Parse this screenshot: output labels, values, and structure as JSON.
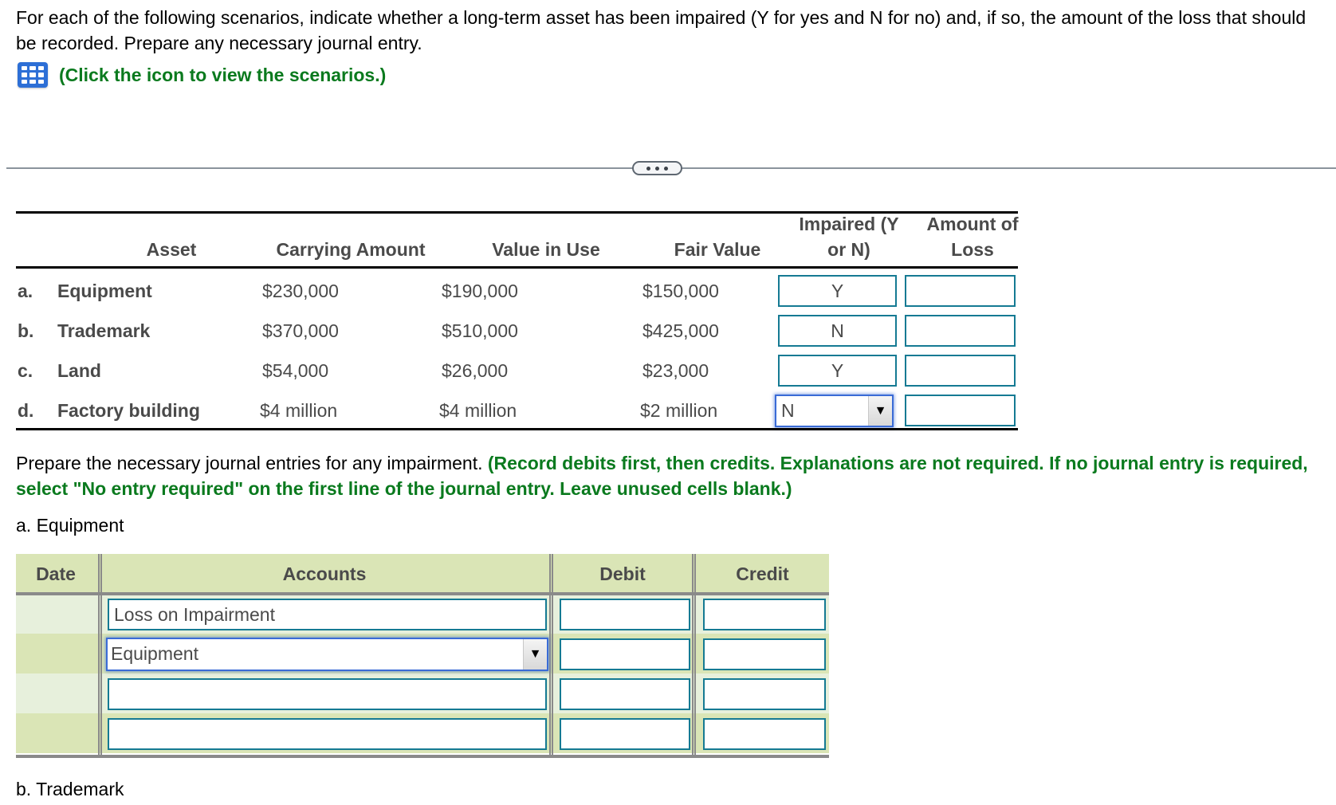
{
  "intro": {
    "text": "For each of the following scenarios, indicate whether a long-term asset has been impaired (Y for yes and N for no) and, if so, the amount of the loss that should be recorded. Prepare any necessary journal entry.",
    "scenarios_link": "(Click the icon to view the scenarios.)",
    "scenarios_icon": "table-grid-icon"
  },
  "divider": {
    "expand_icon": "ellipsis-icon"
  },
  "scenario_table": {
    "headers": {
      "asset": "Asset",
      "carrying_amount": "Carrying Amount",
      "value_in_use": "Value in Use",
      "fair_value": "Fair Value",
      "impaired_line1": "Impaired (Y",
      "impaired_line2": "or N)",
      "loss_line1": "Amount of",
      "loss_line2": "Loss"
    },
    "rows": [
      {
        "letter": "a.",
        "asset": "Equipment",
        "carrying_amount": "$230,000",
        "value_in_use": "$190,000",
        "fair_value": "$150,000",
        "impaired": "Y",
        "loss": ""
      },
      {
        "letter": "b.",
        "asset": "Trademark",
        "carrying_amount": "$370,000",
        "value_in_use": "$510,000",
        "fair_value": "$425,000",
        "impaired": "N",
        "loss": ""
      },
      {
        "letter": "c.",
        "asset": "Land",
        "carrying_amount": "$54,000",
        "value_in_use": "$26,000",
        "fair_value": "$23,000",
        "impaired": "Y",
        "loss": ""
      },
      {
        "letter": "d.",
        "asset": "Factory building",
        "carrying_amount": "$4 million",
        "value_in_use": "$4 million",
        "fair_value": "$2 million",
        "impaired": "N",
        "loss": ""
      }
    ],
    "dropdown_arrow": "▼"
  },
  "instructions": {
    "plain": "Prepare the necessary journal entries for any impairment. ",
    "green": "(Record debits first, then credits. Explanations are not required. If no journal entry is required, select \"No entry required\" on the first line of the journal entry. Leave unused cells blank.)"
  },
  "journal_a": {
    "label": "a. Equipment",
    "headers": {
      "date": "Date",
      "accounts": "Accounts",
      "debit": "Debit",
      "credit": "Credit"
    },
    "rows": [
      {
        "date": "",
        "account": "Loss on Impairment",
        "debit": "",
        "credit": ""
      },
      {
        "date": "",
        "account": "Equipment",
        "debit": "",
        "credit": ""
      },
      {
        "date": "",
        "account": "",
        "debit": "",
        "credit": ""
      },
      {
        "date": "",
        "account": "",
        "debit": "",
        "credit": ""
      }
    ],
    "dropdown_arrow": "▼"
  },
  "journal_b": {
    "label": "b. Trademark"
  },
  "colors": {
    "instruction_green": "#0a7a1e",
    "input_border": "#157a93",
    "focus_border": "#3a6bd6",
    "journal_header_bg": "#dae5b6",
    "journal_row_light": "#e7f0dc"
  }
}
